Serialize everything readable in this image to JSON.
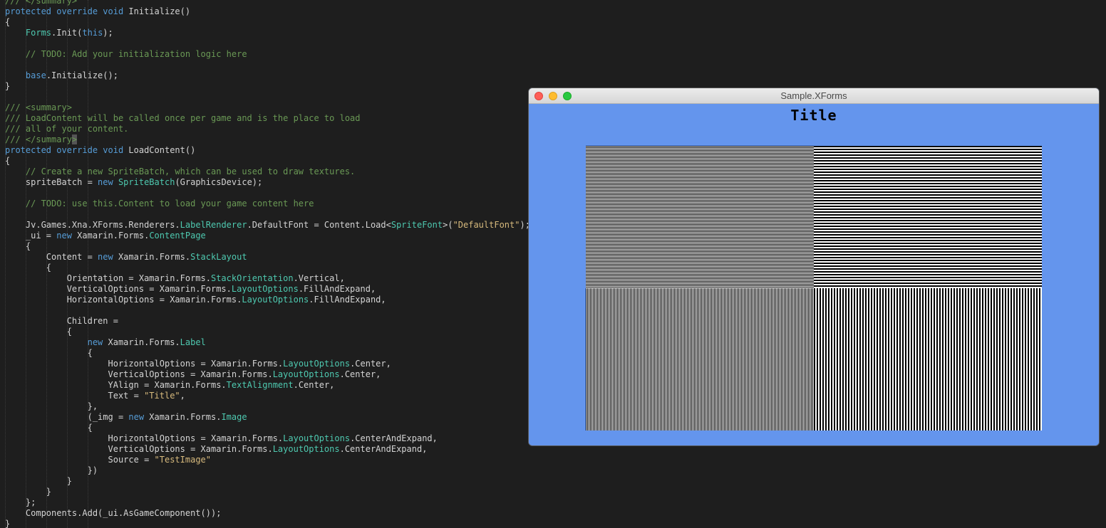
{
  "code": {
    "lines": [
      [
        [
          "cm",
          "/// </summary>"
        ]
      ],
      [
        [
          "kw",
          "protected override void "
        ],
        [
          "tx",
          "Initialize()"
        ]
      ],
      [
        [
          "tx",
          "{"
        ]
      ],
      [
        [
          "tx",
          "    "
        ],
        [
          "ty",
          "Forms"
        ],
        [
          "tx",
          ".Init("
        ],
        [
          "kw",
          "this"
        ],
        [
          "tx",
          ");"
        ]
      ],
      [
        [
          "tx",
          ""
        ]
      ],
      [
        [
          "tx",
          "    "
        ],
        [
          "cm",
          "// TODO: Add your initialization logic here"
        ]
      ],
      [
        [
          "tx",
          ""
        ]
      ],
      [
        [
          "tx",
          "    "
        ],
        [
          "kw",
          "base"
        ],
        [
          "tx",
          ".Initialize();"
        ]
      ],
      [
        [
          "tx",
          "}"
        ]
      ],
      [
        [
          "tx",
          ""
        ]
      ],
      [
        [
          "cm",
          "/// <summary>"
        ]
      ],
      [
        [
          "cm",
          "/// LoadContent will be called once per game and is the place to load"
        ]
      ],
      [
        [
          "cm",
          "/// all of your content."
        ]
      ],
      [
        [
          "cm",
          "/// </summary"
        ],
        [
          "caret",
          ">"
        ]
      ],
      [
        [
          "kw",
          "protected override void "
        ],
        [
          "tx",
          "LoadContent()"
        ]
      ],
      [
        [
          "tx",
          "{"
        ]
      ],
      [
        [
          "tx",
          "    "
        ],
        [
          "cm",
          "// Create a new SpriteBatch, which can be used to draw textures."
        ]
      ],
      [
        [
          "tx",
          "    spriteBatch = "
        ],
        [
          "kw",
          "new "
        ],
        [
          "ty",
          "SpriteBatch"
        ],
        [
          "tx",
          "(GraphicsDevice);"
        ]
      ],
      [
        [
          "tx",
          ""
        ]
      ],
      [
        [
          "tx",
          "    "
        ],
        [
          "cm",
          "// TODO: use this.Content to load your game content here"
        ]
      ],
      [
        [
          "tx",
          ""
        ]
      ],
      [
        [
          "tx",
          "    Jv.Games.Xna.XForms.Renderers."
        ],
        [
          "ty",
          "LabelRenderer"
        ],
        [
          "tx",
          ".DefaultFont = Content.Load<"
        ],
        [
          "ty",
          "SpriteFont"
        ],
        [
          "tx",
          ">("
        ],
        [
          "str",
          "\"DefaultFont\""
        ],
        [
          "tx",
          ");"
        ]
      ],
      [
        [
          "tx",
          "    _ui = "
        ],
        [
          "kw",
          "new "
        ],
        [
          "tx",
          "Xamarin.Forms."
        ],
        [
          "ty",
          "ContentPage"
        ]
      ],
      [
        [
          "tx",
          "    {"
        ]
      ],
      [
        [
          "tx",
          "        Content = "
        ],
        [
          "kw",
          "new "
        ],
        [
          "tx",
          "Xamarin.Forms."
        ],
        [
          "ty",
          "StackLayout"
        ]
      ],
      [
        [
          "tx",
          "        {"
        ]
      ],
      [
        [
          "tx",
          "            Orientation = Xamarin.Forms."
        ],
        [
          "ty",
          "StackOrientation"
        ],
        [
          "tx",
          ".Vertical,"
        ]
      ],
      [
        [
          "tx",
          "            VerticalOptions = Xamarin.Forms."
        ],
        [
          "ty",
          "LayoutOptions"
        ],
        [
          "tx",
          ".FillAndExpand,"
        ]
      ],
      [
        [
          "tx",
          "            HorizontalOptions = Xamarin.Forms."
        ],
        [
          "ty",
          "LayoutOptions"
        ],
        [
          "tx",
          ".FillAndExpand,"
        ]
      ],
      [
        [
          "tx",
          ""
        ]
      ],
      [
        [
          "tx",
          "            Children ="
        ]
      ],
      [
        [
          "tx",
          "            {"
        ]
      ],
      [
        [
          "tx",
          "                "
        ],
        [
          "kw",
          "new "
        ],
        [
          "tx",
          "Xamarin.Forms."
        ],
        [
          "ty",
          "Label"
        ]
      ],
      [
        [
          "tx",
          "                {"
        ]
      ],
      [
        [
          "tx",
          "                    HorizontalOptions = Xamarin.Forms."
        ],
        [
          "ty",
          "LayoutOptions"
        ],
        [
          "tx",
          ".Center,"
        ]
      ],
      [
        [
          "tx",
          "                    VerticalOptions = Xamarin.Forms."
        ],
        [
          "ty",
          "LayoutOptions"
        ],
        [
          "tx",
          ".Center,"
        ]
      ],
      [
        [
          "tx",
          "                    YAlign = Xamarin.Forms."
        ],
        [
          "ty",
          "TextAlignment"
        ],
        [
          "tx",
          ".Center,"
        ]
      ],
      [
        [
          "tx",
          "                    Text = "
        ],
        [
          "str",
          "\"Title\""
        ],
        [
          "tx",
          ","
        ]
      ],
      [
        [
          "tx",
          "                },"
        ]
      ],
      [
        [
          "tx",
          "                (_img = "
        ],
        [
          "kw",
          "new "
        ],
        [
          "tx",
          "Xamarin.Forms."
        ],
        [
          "ty",
          "Image"
        ]
      ],
      [
        [
          "tx",
          "                {"
        ]
      ],
      [
        [
          "tx",
          "                    HorizontalOptions = Xamarin.Forms."
        ],
        [
          "ty",
          "LayoutOptions"
        ],
        [
          "tx",
          ".CenterAndExpand,"
        ]
      ],
      [
        [
          "tx",
          "                    VerticalOptions = Xamarin.Forms."
        ],
        [
          "ty",
          "LayoutOptions"
        ],
        [
          "tx",
          ".CenterAndExpand,"
        ]
      ],
      [
        [
          "tx",
          "                    Source = "
        ],
        [
          "str",
          "\"TestImage\""
        ]
      ],
      [
        [
          "tx",
          "                })"
        ]
      ],
      [
        [
          "tx",
          "            }"
        ]
      ],
      [
        [
          "tx",
          "        }"
        ]
      ],
      [
        [
          "tx",
          "    };"
        ]
      ],
      [
        [
          "tx",
          "    Components.Add(_ui.AsGameComponent());"
        ]
      ],
      [
        [
          "tx",
          "}"
        ]
      ]
    ]
  },
  "app_window": {
    "title": "Sample.XForms",
    "background_color": "#6495ed",
    "label_text": "Title",
    "image_name": "TestImage"
  },
  "colors": {
    "editor_background": "#1e1e1e",
    "keyword": "#569cd6",
    "type": "#4ec9b0",
    "string": "#d7ba7d",
    "comment": "#6a9955"
  }
}
